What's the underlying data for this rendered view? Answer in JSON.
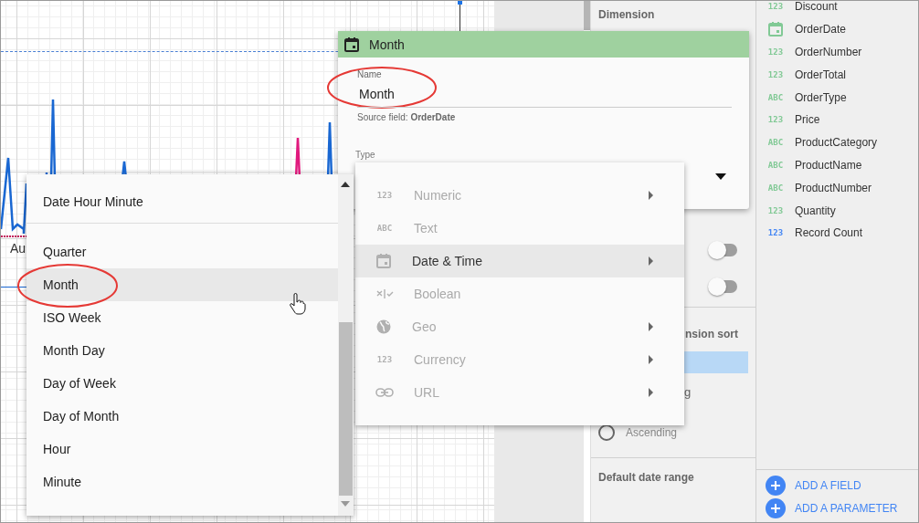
{
  "chart": {
    "x_label": "Au"
  },
  "properties_panel": {
    "section_title": "Dimension",
    "toggles": [
      {
        "on": false
      },
      {
        "on": false
      }
    ],
    "sort_label": "nsion sort",
    "fragment": "g",
    "sort_options": [
      {
        "label": "Ascending",
        "selected": false
      }
    ],
    "date_range_title": "Default date range"
  },
  "fields": [
    {
      "kind": "badge",
      "badge": "123",
      "name": "Discount",
      "color": "#81c995"
    },
    {
      "kind": "date",
      "name": "OrderDate",
      "color": "#81c995"
    },
    {
      "kind": "badge",
      "badge": "123",
      "name": "OrderNumber",
      "color": "#81c995"
    },
    {
      "kind": "badge",
      "badge": "123",
      "name": "OrderTotal",
      "color": "#81c995"
    },
    {
      "kind": "badge",
      "badge": "ABC",
      "name": "OrderType",
      "color": "#81c995"
    },
    {
      "kind": "badge",
      "badge": "123",
      "name": "Price",
      "color": "#81c995"
    },
    {
      "kind": "badge",
      "badge": "ABC",
      "name": "ProductCategory",
      "color": "#81c995"
    },
    {
      "kind": "badge",
      "badge": "ABC",
      "name": "ProductName",
      "color": "#81c995"
    },
    {
      "kind": "badge",
      "badge": "ABC",
      "name": "ProductNumber",
      "color": "#81c995"
    },
    {
      "kind": "badge",
      "badge": "123",
      "name": "Quantity",
      "color": "#81c995"
    },
    {
      "kind": "badge",
      "badge": "123",
      "name": "Record Count",
      "color": "#4285f4"
    }
  ],
  "field_actions": [
    {
      "label": "ADD A FIELD"
    },
    {
      "label": "ADD A PARAMETER"
    }
  ],
  "dimension_editor": {
    "title": "Month",
    "name_label": "Name",
    "name_value": "Month",
    "source_field": "Source field: **OrderDate**",
    "type_label": "Type"
  },
  "type_menu": [
    {
      "kind": "badge",
      "badge": "123",
      "label": "Numeric",
      "has_submenu": true,
      "selected": false
    },
    {
      "kind": "badge",
      "badge": "ABC",
      "label": "Text",
      "has_submenu": false,
      "selected": false
    },
    {
      "kind": "date",
      "label": "Date & Time",
      "has_submenu": true,
      "selected": true
    },
    {
      "kind": "boolean",
      "label": "Boolean",
      "has_submenu": false,
      "selected": false
    },
    {
      "kind": "geo",
      "label": "Geo",
      "has_submenu": true,
      "selected": false
    },
    {
      "kind": "badge",
      "badge": "123",
      "label": "Currency",
      "has_submenu": true,
      "selected": false
    },
    {
      "kind": "url",
      "label": "URL",
      "has_submenu": true,
      "selected": false
    }
  ],
  "date_menu": {
    "groups": [
      [
        {
          "label": "Date Hour Minute",
          "selected": false
        }
      ],
      [
        {
          "label": "Quarter",
          "selected": false
        },
        {
          "label": "Month",
          "selected": true
        },
        {
          "label": "ISO Week",
          "selected": false
        },
        {
          "label": "Month Day",
          "selected": false
        },
        {
          "label": "Day of Week",
          "selected": false
        },
        {
          "label": "Day of Month",
          "selected": false
        },
        {
          "label": "Hour",
          "selected": false
        },
        {
          "label": "Minute",
          "selected": false
        }
      ]
    ]
  }
}
